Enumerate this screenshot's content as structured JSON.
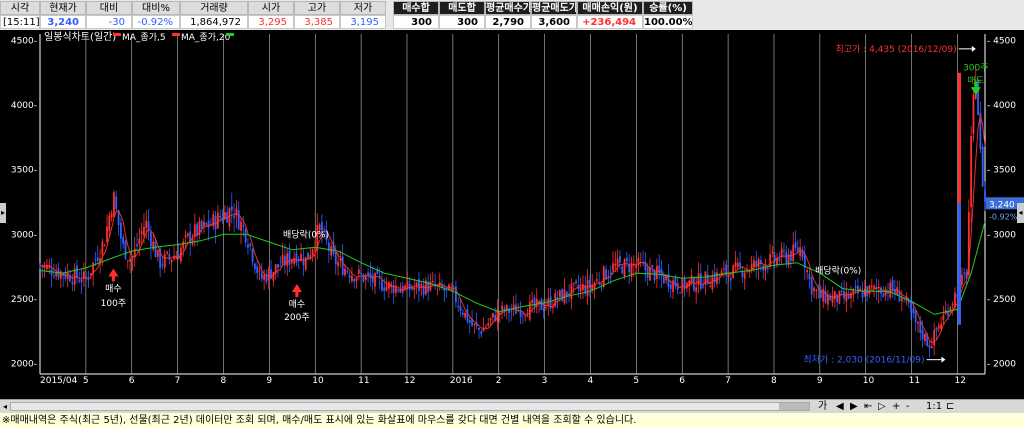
{
  "quote": {
    "headers": [
      "시각",
      "현재가",
      "대비",
      "대비%",
      "거래량",
      "시가",
      "고가",
      "저가",
      "매수합",
      "매도합",
      "평균매수가",
      "평균매도가",
      "매매손익(원)",
      "승률(%)"
    ],
    "values": [
      "[15:11]",
      "3,240",
      "-30",
      "-0.92%",
      "1,864,972",
      "3,295",
      "3,385",
      "3,195",
      "300",
      "300",
      "2,790",
      "3,600",
      "+236,494",
      "100.00%"
    ]
  },
  "colors": {
    "up": "#ff3030",
    "down": "#3060ff",
    "ma5": "#ff3030",
    "ma20": "#22cc22",
    "axis": "#ffffff",
    "grid": "#ffffff"
  },
  "chart_data": {
    "type": "candlestick",
    "title": "일봉식차트(일간)",
    "legend": [
      "MA_종가,5",
      "MA_종가,20"
    ],
    "y_ticks": [
      2000,
      2500,
      3000,
      3500,
      4000,
      4500
    ],
    "y_tick_labels": [
      "2000-",
      "2500-",
      "3000-",
      "3500-",
      "4000-",
      "4500-"
    ],
    "right_tick_labels": [
      "- 2000",
      "- 2500",
      "- 3000",
      "- 3500",
      "- 4000",
      "- 4500"
    ],
    "ylim": [
      1950,
      4550
    ],
    "x_tick_labels": [
      "2015/04",
      "5",
      "6",
      "7",
      "8",
      "9",
      "10",
      "11",
      "12",
      "2016",
      "2",
      "3",
      "4",
      "5",
      "6",
      "7",
      "8",
      "9",
      "10",
      "11",
      "12"
    ],
    "x_tick_pos": [
      0,
      1,
      2,
      3,
      4,
      5,
      6,
      7,
      8,
      9,
      10,
      11,
      12,
      13,
      14,
      15,
      16,
      17,
      18,
      19,
      20
    ],
    "x_count": 20.6,
    "price_path": [
      [
        0,
        2760
      ],
      [
        0.5,
        2700
      ],
      [
        1,
        2650
      ],
      [
        1.4,
        2950
      ],
      [
        1.6,
        3300
      ],
      [
        1.8,
        2900
      ],
      [
        2,
        2800
      ],
      [
        2.3,
        3100
      ],
      [
        2.6,
        2780
      ],
      [
        3,
        2850
      ],
      [
        3.3,
        3000
      ],
      [
        3.6,
        3050
      ],
      [
        4,
        3150
      ],
      [
        4.2,
        3200
      ],
      [
        4.5,
        3000
      ],
      [
        4.8,
        2650
      ],
      [
        5,
        2700
      ],
      [
        5.3,
        2780
      ],
      [
        5.6,
        2850
      ],
      [
        5.8,
        2800
      ],
      [
        6.1,
        3050
      ],
      [
        6.4,
        2800
      ],
      [
        6.8,
        2700
      ],
      [
        7.2,
        2650
      ],
      [
        7.6,
        2600
      ],
      [
        8,
        2580
      ],
      [
        8.5,
        2600
      ],
      [
        9,
        2540
      ],
      [
        9.4,
        2300
      ],
      [
        9.6,
        2250
      ],
      [
        10,
        2400
      ],
      [
        10.5,
        2420
      ],
      [
        11,
        2450
      ],
      [
        11.5,
        2550
      ],
      [
        12,
        2600
      ],
      [
        12.5,
        2750
      ],
      [
        13,
        2760
      ],
      [
        13.5,
        2680
      ],
      [
        14,
        2600
      ],
      [
        14.5,
        2650
      ],
      [
        15,
        2700
      ],
      [
        15.5,
        2750
      ],
      [
        16,
        2800
      ],
      [
        16.4,
        2850
      ],
      [
        16.6,
        2900
      ],
      [
        16.8,
        2600
      ],
      [
        17,
        2520
      ],
      [
        17.5,
        2500
      ],
      [
        18,
        2560
      ],
      [
        18.5,
        2580
      ],
      [
        18.8,
        2520
      ],
      [
        19.1,
        2300
      ],
      [
        19.4,
        2140
      ],
      [
        19.6,
        2300
      ],
      [
        20.2,
        2700
      ],
      [
        20.3,
        3700
      ],
      [
        20.4,
        4300
      ],
      [
        20.5,
        3600
      ],
      [
        20.6,
        3240
      ]
    ],
    "ma20_path": [
      [
        0,
        2720
      ],
      [
        0.5,
        2700
      ],
      [
        1,
        2740
      ],
      [
        1.6,
        2820
      ],
      [
        2,
        2870
      ],
      [
        2.5,
        2900
      ],
      [
        3,
        2920
      ],
      [
        3.5,
        2950
      ],
      [
        4,
        3000
      ],
      [
        4.5,
        3000
      ],
      [
        5,
        2940
      ],
      [
        5.5,
        2880
      ],
      [
        6,
        2900
      ],
      [
        6.5,
        2870
      ],
      [
        7,
        2780
      ],
      [
        7.5,
        2700
      ],
      [
        8,
        2660
      ],
      [
        8.5,
        2620
      ],
      [
        9,
        2560
      ],
      [
        9.5,
        2470
      ],
      [
        10,
        2400
      ],
      [
        10.5,
        2440
      ],
      [
        11,
        2470
      ],
      [
        11.5,
        2520
      ],
      [
        12,
        2560
      ],
      [
        12.5,
        2640
      ],
      [
        13,
        2700
      ],
      [
        13.5,
        2690
      ],
      [
        14,
        2660
      ],
      [
        14.5,
        2670
      ],
      [
        15,
        2700
      ],
      [
        15.5,
        2720
      ],
      [
        16,
        2760
      ],
      [
        16.5,
        2780
      ],
      [
        17,
        2700
      ],
      [
        17.5,
        2580
      ],
      [
        18,
        2560
      ],
      [
        18.5,
        2560
      ],
      [
        19,
        2480
      ],
      [
        19.5,
        2380
      ],
      [
        20,
        2420
      ],
      [
        20.3,
        2700
      ],
      [
        20.6,
        3100
      ]
    ],
    "annotations": [
      {
        "text": "최고가 : 4,435 (2016/12/09)",
        "x": 20.2,
        "y": 4435,
        "color": "#ff3030"
      },
      {
        "text": "최저가 : 2,030 (2016/11/09)",
        "x": 19.5,
        "y": 2030,
        "color": "#3060ff"
      },
      {
        "text": "배당락(0%)",
        "x": 5.8,
        "y": 3000,
        "color": "#ffffff"
      },
      {
        "text": "배당락(0%)",
        "x": 17.4,
        "y": 2720,
        "color": "#ffffff"
      },
      {
        "text": "매수",
        "x": 1.6,
        "y": 2580,
        "color": "#ffffff"
      },
      {
        "text": "100주",
        "x": 1.6,
        "y": 2470,
        "color": "#ffffff"
      },
      {
        "text": "매수",
        "x": 5.6,
        "y": 2460,
        "color": "#ffffff"
      },
      {
        "text": "200주",
        "x": 5.6,
        "y": 2360,
        "color": "#ffffff"
      },
      {
        "text": "300주",
        "x": 20.4,
        "y": 4290,
        "color": "#22cc22"
      },
      {
        "text": "매도",
        "x": 20.4,
        "y": 4190,
        "color": "#22cc22"
      }
    ],
    "buy_markers": [
      {
        "x": 1.6,
        "y": 2720
      },
      {
        "x": 5.6,
        "y": 2600
      }
    ],
    "sell_markers": [
      {
        "x": 20.4,
        "y": 4100
      }
    ],
    "price_box": {
      "price": "3,240",
      "change": "-0.92%",
      "value": 3240
    },
    "range_bar": {
      "high": 4250,
      "low": 2300
    }
  },
  "scroll": {
    "tools": [
      "가",
      "◀",
      "▶",
      "⇤",
      "▷",
      "+",
      "-",
      "1:1",
      "⊏"
    ]
  },
  "notice": "※매매내역은 주식(최근 5년), 선물(최근 2년) 데이터만 조회 되며, 매수/매도 표시에 있는 화살표에 마우스를 갖다 대면 건별 내역을 조회할 수 있습니다."
}
